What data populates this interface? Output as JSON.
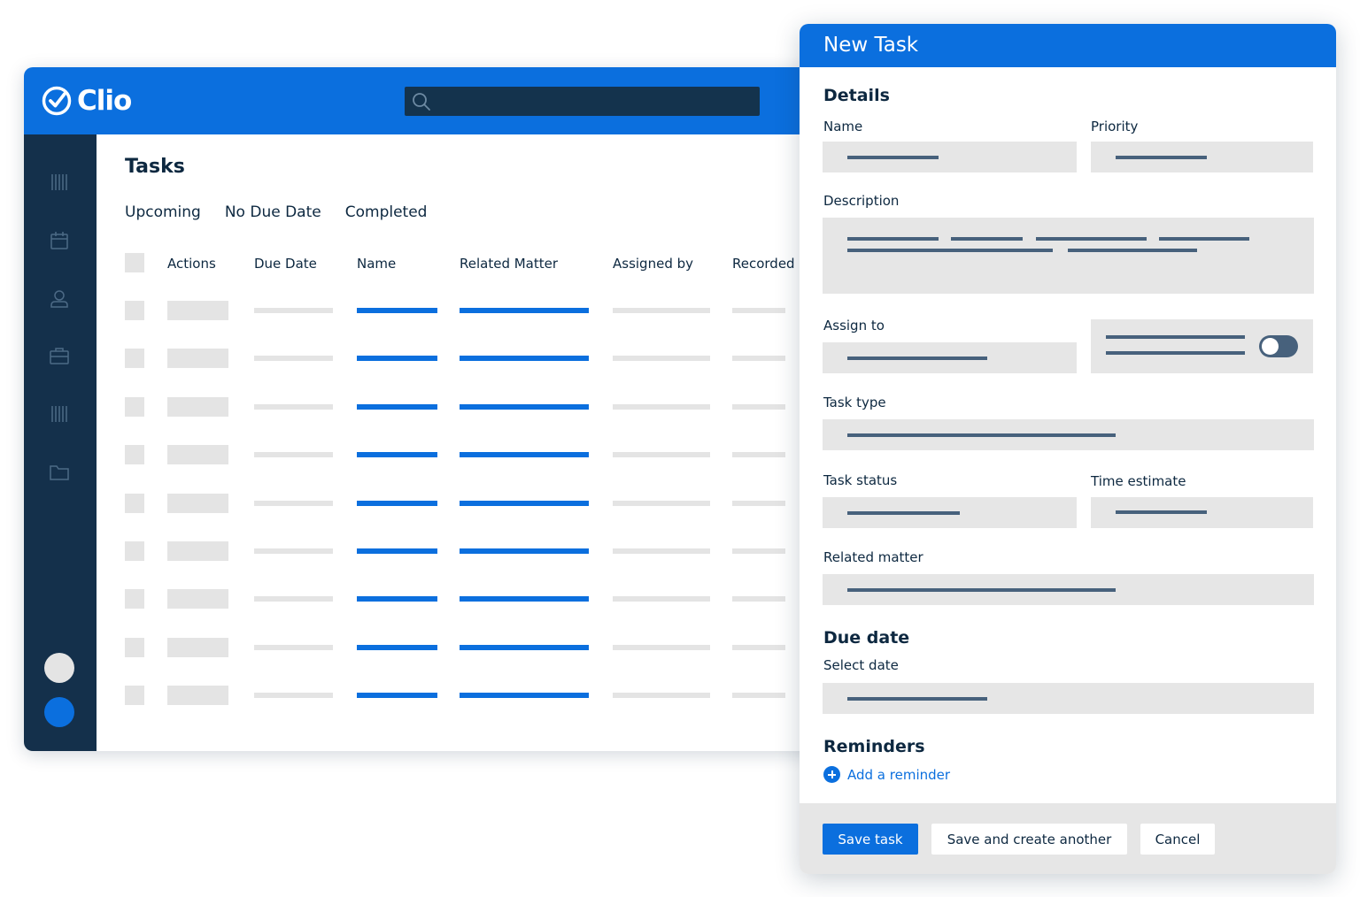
{
  "app": {
    "brand": "Clio",
    "search": {
      "placeholder": ""
    },
    "page_title": "Tasks",
    "tabs": [
      "Upcoming",
      "No Due Date",
      "Completed"
    ],
    "columns": [
      "Actions",
      "Due Date",
      "Name",
      "Related Matter",
      "Assigned by",
      "Recorded"
    ],
    "sidebar_icons": [
      "barcode-icon",
      "calendar-icon",
      "user-icon",
      "briefcase-icon",
      "barcode-icon",
      "folder-icon"
    ],
    "row_count": 9
  },
  "modal": {
    "title": "New Task",
    "details_heading": "Details",
    "name_label": "Name",
    "priority_label": "Priority",
    "description_label": "Description",
    "assign_to_label": "Assign to",
    "task_type_label": "Task type",
    "task_status_label": "Task status",
    "time_estimate_label": "Time estimate",
    "related_matter_label": "Related matter",
    "due_date_heading": "Due date",
    "select_date_label": "Select date",
    "reminders_heading": "Reminders",
    "add_reminder": "Add a reminder",
    "buttons": {
      "save": "Save task",
      "save_another": "Save and create another",
      "cancel": "Cancel"
    }
  },
  "colors": {
    "brand_blue": "#0b6fde",
    "sidebar_navy": "#14304b",
    "placeholder_grey": "#e4e4e4"
  }
}
